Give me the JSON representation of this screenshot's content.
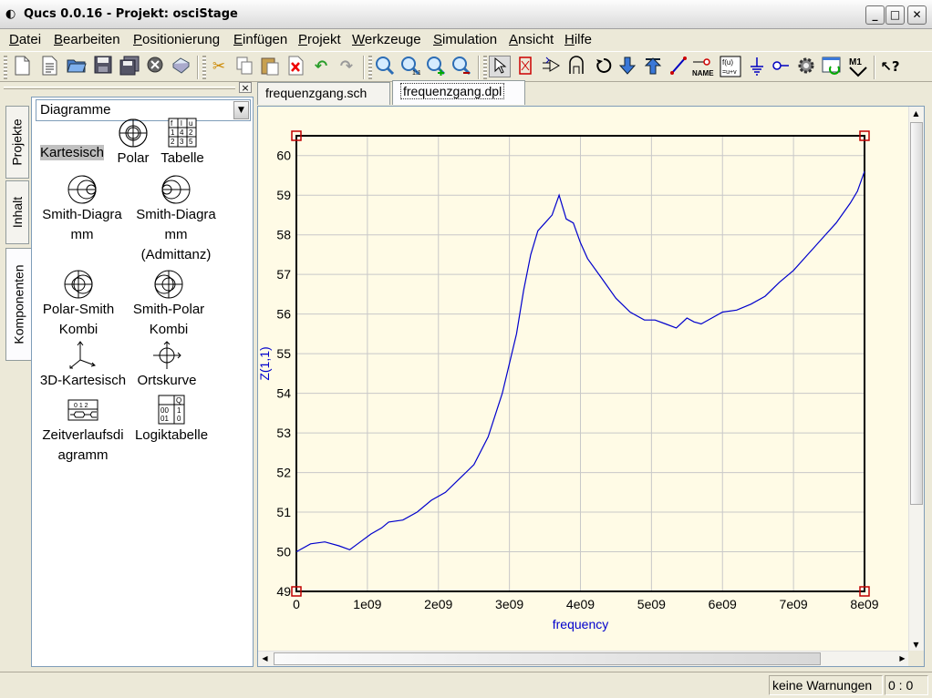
{
  "window": {
    "title": "Qucs 0.0.16 - Projekt: osciStage",
    "minimize": "_",
    "maximize": "□",
    "close": "✕"
  },
  "menu": [
    "Datei",
    "Bearbeiten",
    "Positionierung",
    "Einfügen",
    "Projekt",
    "Werkzeuge",
    "Simulation",
    "Ansicht",
    "Hilfe"
  ],
  "toolbar": {
    "icons": [
      "new-file-icon",
      "new-text-icon",
      "open-icon",
      "save-icon",
      "save-all-icon",
      "close-doc-icon",
      "print-icon",
      "cut-icon",
      "copy-icon",
      "paste-icon",
      "delete-icon",
      "undo-icon",
      "redo-icon",
      "zoom-fit-icon",
      "zoom-1to1-icon",
      "zoom-in-icon",
      "zoom-out-icon",
      "select-icon",
      "deactivate-icon",
      "mirror-x-icon",
      "mirror-y-icon",
      "rotate-icon",
      "go-into-icon",
      "go-up-icon",
      "wire-icon",
      "wire-label-icon",
      "equation-icon",
      "ground-icon",
      "port-icon",
      "simulate-icon",
      "view-data-icon",
      "marker-icon",
      "whats-this-icon"
    ],
    "equation_label": "f(u)",
    "marker_label": "M1",
    "label_icon_text": "NAME"
  },
  "dock": {
    "close": "×",
    "tabs": [
      "Projekte",
      "Inhalt",
      "Komponenten"
    ],
    "active_tab": "Komponenten",
    "combo_value": "Diagramme",
    "components": [
      {
        "label": "Kartesisch",
        "selected": true
      },
      {
        "label": "Polar"
      },
      {
        "label": "Tabelle"
      },
      {
        "label": "Smith-Diagra mm"
      },
      {
        "label": "Smith-Diagra mm (Admittanz)"
      },
      {
        "label": "Polar-Smith Kombi"
      },
      {
        "label": "Smith-Polar Kombi"
      },
      {
        "label": "3D-Kartesisch"
      },
      {
        "label": "Ortskurve"
      },
      {
        "label": "Zeitverlaufsdi agramm"
      },
      {
        "label": "Logiktabelle"
      }
    ],
    "table_icon_text": [
      "f",
      "l",
      "u",
      "1",
      "4",
      "2",
      "2",
      "3",
      "5"
    ],
    "logic_icon_text": [
      "Q",
      "00",
      "1",
      "01",
      "0"
    ],
    "timing_icon_text": "0 1 2"
  },
  "tabs": [
    {
      "label": "frequenzgang.sch"
    },
    {
      "label": "frequenzgang.dpl",
      "active": true
    }
  ],
  "chart_data": {
    "type": "line",
    "xlabel": "frequency",
    "ylabel": "Z(1,1)",
    "xlim": [
      0,
      8000000000
    ],
    "ylim": [
      49,
      60.5
    ],
    "xticks": [
      "0",
      "1e09",
      "2e09",
      "3e09",
      "4e09",
      "5e09",
      "6e09",
      "7e09",
      "8e09"
    ],
    "yticks": [
      "49",
      "50",
      "51",
      "52",
      "53",
      "54",
      "55",
      "56",
      "57",
      "58",
      "59",
      "60"
    ],
    "grid": true,
    "series": [
      {
        "color": "#0000cc",
        "x": [
          0,
          200000000.0,
          400000000.0,
          600000000.0,
          750000000.0,
          900000000.0,
          1050000000.0,
          1200000000.0,
          1300000000.0,
          1500000000.0,
          1700000000.0,
          1900000000.0,
          2100000000.0,
          2300000000.0,
          2500000000.0,
          2700000000.0,
          2900000000.0,
          3100000000.0,
          3200000000.0,
          3300000000.0,
          3400000000.0,
          3500000000.0,
          3600000000.0,
          3700000000.0,
          3800000000.0,
          3900000000.0,
          4000000000.0,
          4100000000.0,
          4300000000.0,
          4500000000.0,
          4700000000.0,
          4900000000.0,
          5050000000.0,
          5200000000.0,
          5350000000.0,
          5500000000.0,
          5600000000.0,
          5700000000.0,
          5850000000.0,
          6000000000.0,
          6200000000.0,
          6400000000.0,
          6600000000.0,
          6800000000.0,
          7000000000.0,
          7200000000.0,
          7400000000.0,
          7600000000.0,
          7800000000.0,
          7900000000.0,
          8000000000.0
        ],
        "y": [
          50.0,
          50.2,
          50.25,
          50.15,
          50.05,
          50.25,
          50.45,
          50.6,
          50.75,
          50.8,
          51.0,
          51.3,
          51.5,
          51.85,
          52.2,
          52.9,
          54.0,
          55.5,
          56.6,
          57.5,
          58.1,
          58.3,
          58.5,
          59.0,
          58.4,
          58.3,
          57.8,
          57.4,
          56.9,
          56.4,
          56.05,
          55.85,
          55.85,
          55.75,
          55.65,
          55.9,
          55.8,
          55.75,
          55.9,
          56.05,
          56.1,
          56.25,
          56.45,
          56.8,
          57.1,
          57.5,
          57.9,
          58.3,
          58.8,
          59.1,
          59.6
        ]
      }
    ]
  },
  "status": {
    "warnings": "keine Warnungen",
    "position": "0 : 0"
  }
}
